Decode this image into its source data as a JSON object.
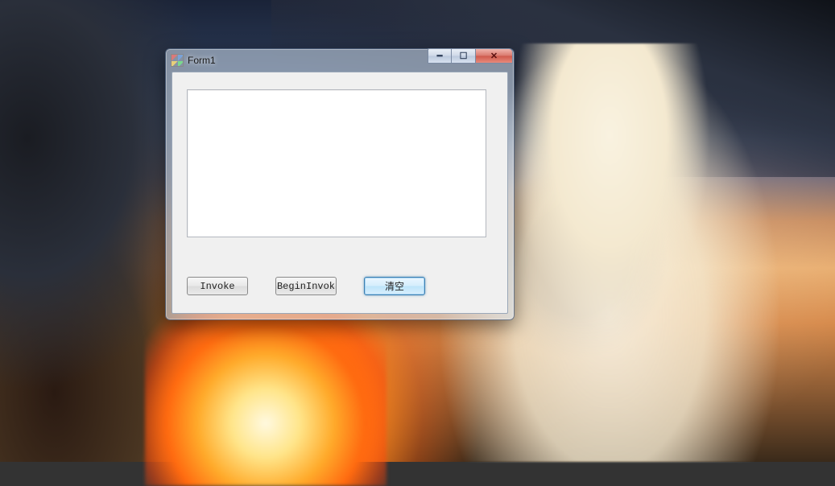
{
  "background": {
    "description": "anime steampunk wallpaper with girl, machinery, sunset clouds and fire",
    "accent_fire": "#ff8a1d",
    "sky_top": "#1a2338",
    "sky_mid": "#c78b5e"
  },
  "window": {
    "title": "Form1",
    "icon": "winforms-default-icon",
    "controls": {
      "minimize_glyph": "━",
      "maximize_glyph": "☐",
      "close_glyph": "✕"
    }
  },
  "form": {
    "textbox_value": "",
    "buttons": {
      "invoke": "Invoke",
      "begin_invoke": "BeginInvok",
      "clear": "清空"
    },
    "focused_button": "clear"
  }
}
